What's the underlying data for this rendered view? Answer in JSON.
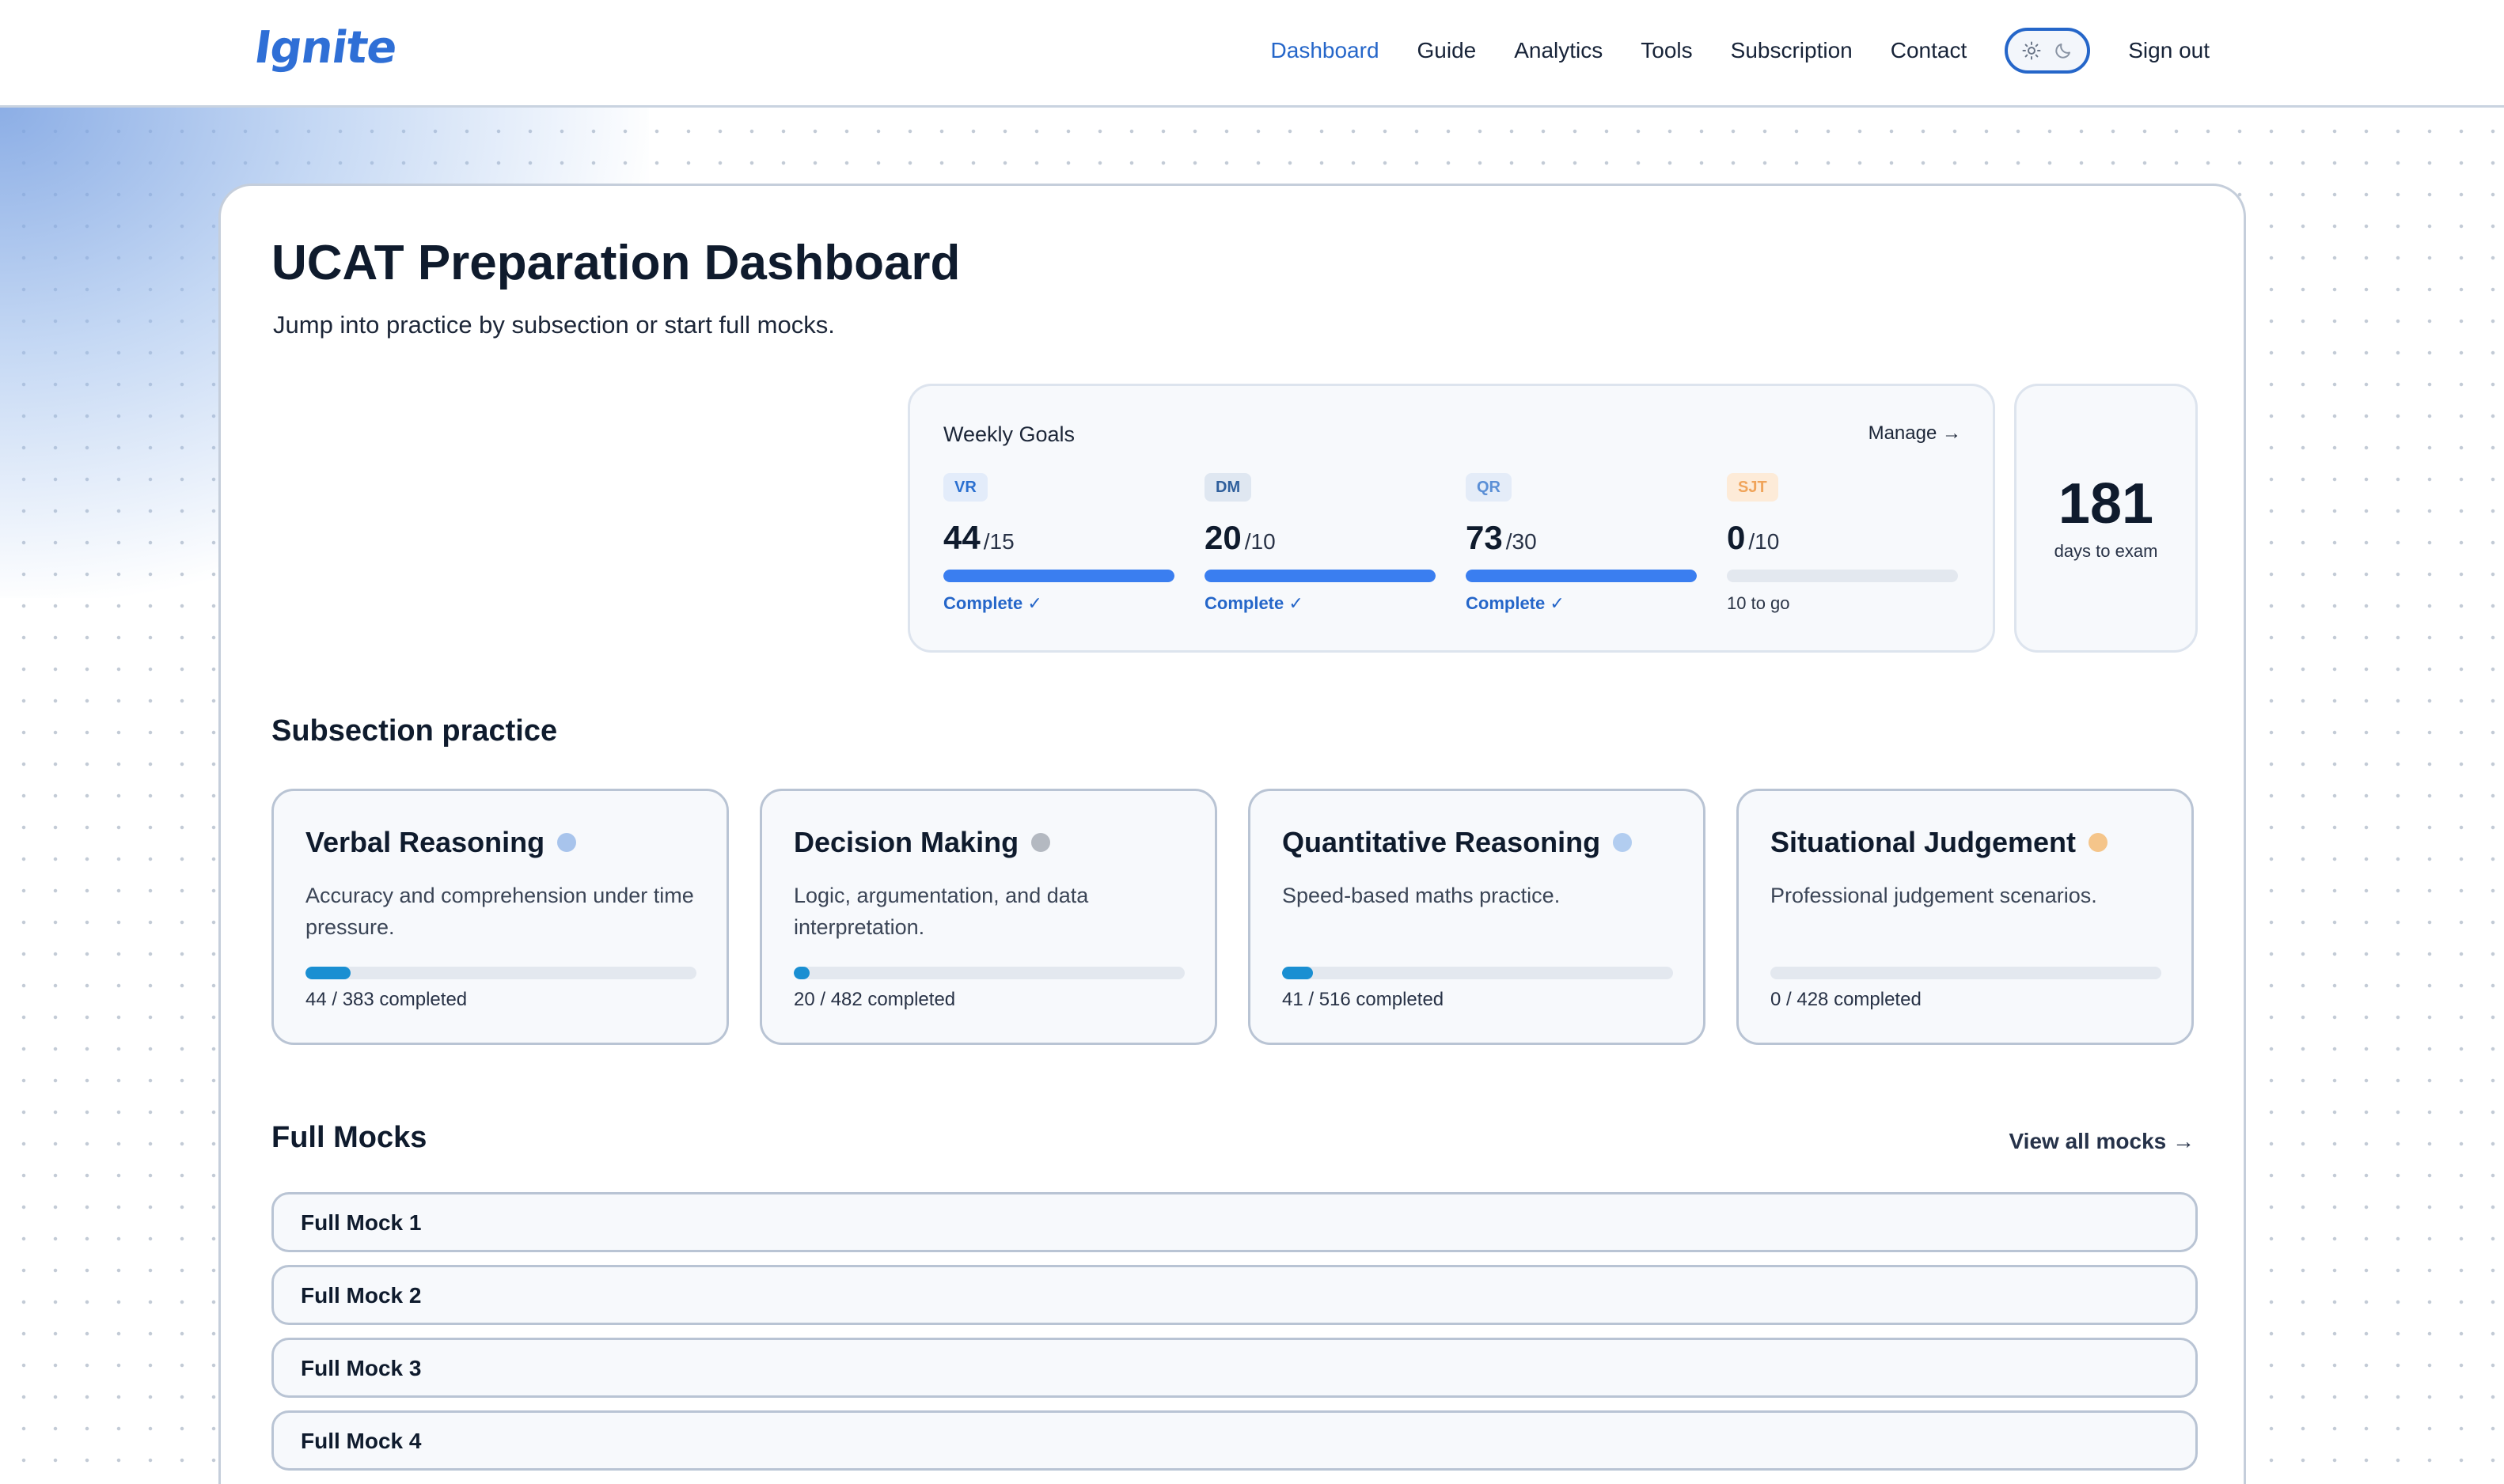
{
  "brand": {
    "name": "Ignite"
  },
  "nav": {
    "items": [
      {
        "label": "Dashboard",
        "active": true
      },
      {
        "label": "Guide",
        "active": false
      },
      {
        "label": "Analytics",
        "active": false
      },
      {
        "label": "Tools",
        "active": false
      },
      {
        "label": "Subscription",
        "active": false
      },
      {
        "label": "Contact",
        "active": false
      }
    ],
    "sign_out": "Sign out"
  },
  "page": {
    "title": "UCAT Preparation Dashboard",
    "subtitle": "Jump into practice by subsection or start full mocks."
  },
  "weekly_goals": {
    "title": "Weekly Goals",
    "manage": "Manage →",
    "goals": [
      {
        "badge": "VR",
        "value": "44",
        "target": "/15",
        "progress": 1.0,
        "status": "Complete ✓",
        "complete": true,
        "badge_bg": "#e3ecfa",
        "badge_fg": "#2a6fd0"
      },
      {
        "badge": "DM",
        "value": "20",
        "target": "/10",
        "progress": 1.0,
        "status": "Complete ✓",
        "complete": true,
        "badge_bg": "#dfe7f1",
        "badge_fg": "#2f5f9c"
      },
      {
        "badge": "QR",
        "value": "73",
        "target": "/30",
        "progress": 1.0,
        "status": "Complete ✓",
        "complete": true,
        "badge_bg": "#e4ecf8",
        "badge_fg": "#5b8fd6"
      },
      {
        "badge": "SJT",
        "value": "0",
        "target": "/10",
        "progress": 0.0,
        "status": "10 to go",
        "complete": false,
        "badge_bg": "#fdebd8",
        "badge_fg": "#f0a45a"
      }
    ]
  },
  "exam_countdown": {
    "days": "181",
    "label": "days to exam"
  },
  "subsection_practice": {
    "title": "Subsection practice",
    "cards": [
      {
        "name": "Verbal Reasoning",
        "description": "Accuracy and comprehension under time pressure.",
        "completed": "44 / 383 completed",
        "progress": 0.115,
        "dot_color": "#a8c4ec"
      },
      {
        "name": "Decision Making",
        "description": "Logic, argumentation, and data interpretation.",
        "completed": "20 / 482 completed",
        "progress": 0.041,
        "dot_color": "#b4b9c1"
      },
      {
        "name": "Quantitative Reasoning",
        "description": "Speed-based maths practice.",
        "completed": "41 / 516 completed",
        "progress": 0.079,
        "dot_color": "#b2cdf0"
      },
      {
        "name": "Situational Judgement",
        "description": "Professional judgement scenarios.",
        "completed": "0 / 428 completed",
        "progress": 0.0,
        "dot_color": "#f5c58a"
      }
    ]
  },
  "full_mocks": {
    "title": "Full Mocks",
    "view_all": "View all mocks →",
    "items": [
      {
        "label": "Full Mock 1"
      },
      {
        "label": "Full Mock 2"
      },
      {
        "label": "Full Mock 3"
      },
      {
        "label": "Full Mock 4"
      }
    ]
  }
}
